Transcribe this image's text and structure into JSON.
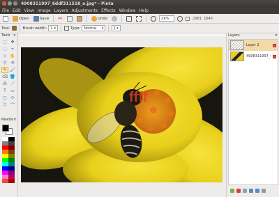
{
  "window": {
    "title": "4908311997_6ddf311518_o.jpg* - Pinta",
    "close_glyph": "×",
    "minimize_glyph": "–",
    "maximize_glyph": "□"
  },
  "menu": [
    "File",
    "Edit",
    "View",
    "Image",
    "Layers",
    "Adjustments",
    "Effects",
    "Window",
    "Help"
  ],
  "toolbar": {
    "new_label": "",
    "open_label": "Open",
    "save_label": "Save",
    "cut_icon": "✂",
    "undo_label": "Undo",
    "zoom_value": "26%",
    "coords": "2981, 1646"
  },
  "tool_options": {
    "tool_label": "Tool:",
    "brush_width_label": "Brush width:",
    "brush_width_value": "1",
    "type_label": "Type:",
    "type_value": "Normal"
  },
  "panels": {
    "tools_title": "Tools",
    "palette_title": "Palette",
    "layers_title": "Layers"
  },
  "tools": [
    "⬚",
    "✥",
    "◌",
    "⌖",
    "⊹",
    "✋",
    "⚲",
    "⟲",
    "✎",
    "🖌",
    "⌫",
    "🪣",
    "⁂",
    "⟋",
    "T",
    "▭",
    "▢",
    "⬭",
    "⬡",
    "⌒"
  ],
  "palette_colors": [
    "#ffffff",
    "#000000",
    "#808080",
    "#404040",
    "#ff0000",
    "#800000",
    "#ff8000",
    "#804000",
    "#ffff00",
    "#808000",
    "#00ff00",
    "#008000",
    "#00ffff",
    "#008080",
    "#0000ff",
    "#000080",
    "#ff00ff",
    "#800080",
    "#ff80c0",
    "#c00060",
    "#ff4040",
    "#a00000"
  ],
  "layers": [
    {
      "name": "Layer 2"
    },
    {
      "name": "4908311997_6..."
    }
  ],
  "image": {
    "watermark": "ffff"
  }
}
